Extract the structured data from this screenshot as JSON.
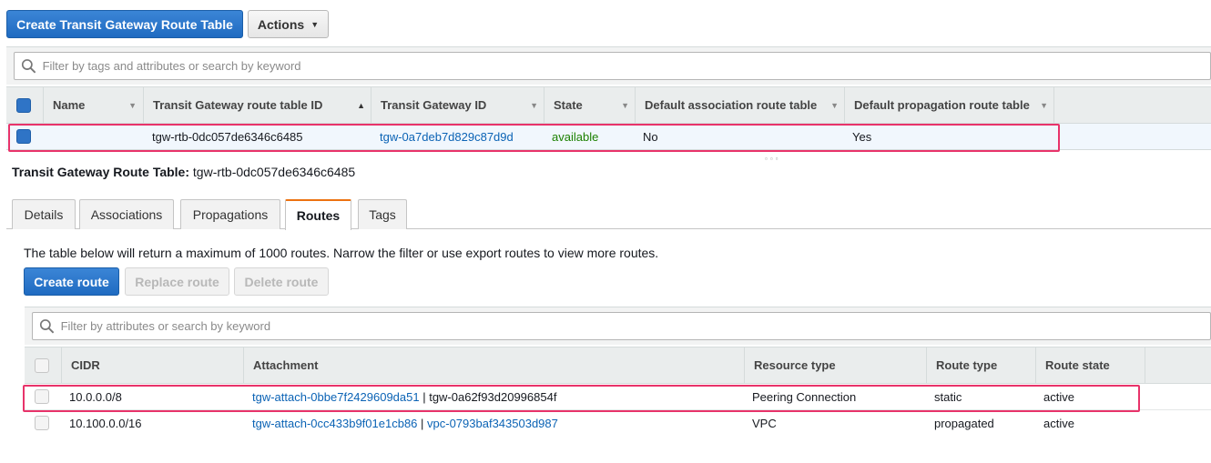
{
  "toolbar": {
    "create_label": "Create Transit Gateway Route Table",
    "actions_label": "Actions"
  },
  "top_search": {
    "placeholder": "Filter by tags and attributes or search by keyword"
  },
  "top_table": {
    "columns": [
      "Name",
      "Transit Gateway route table ID",
      "Transit Gateway ID",
      "State",
      "Default association route table",
      "Default propagation route table"
    ],
    "rows": [
      {
        "name": "",
        "route_table_id": "tgw-rtb-0dc057de6346c6485",
        "tgw_id": "tgw-0a7deb7d829c87d9d",
        "state": "available",
        "default_association": "No",
        "default_propagation": "Yes"
      }
    ]
  },
  "detail": {
    "title_label": "Transit Gateway Route Table:",
    "title_value": "tgw-rtb-0dc057de6346c6485"
  },
  "tabs": [
    {
      "label": "Details"
    },
    {
      "label": "Associations"
    },
    {
      "label": "Propagations"
    },
    {
      "label": "Routes"
    },
    {
      "label": "Tags"
    }
  ],
  "routes": {
    "notice": "The table below will return a maximum of 1000 routes. Narrow the filter or use export routes to view more routes.",
    "create_label": "Create route",
    "replace_label": "Replace route",
    "delete_label": "Delete route",
    "search_placeholder": "Filter by attributes or search by keyword",
    "columns": [
      "CIDR",
      "Attachment",
      "Resource type",
      "Route type",
      "Route state"
    ],
    "rows": [
      {
        "cidr": "10.0.0.0/8",
        "attachment": "tgw-attach-0bbe7f2429609da51",
        "separator": " | ",
        "resource": "tgw-0a62f93d20996854f",
        "resource_is_link": false,
        "resource_type": "Peering Connection",
        "route_type": "static",
        "route_state": "active"
      },
      {
        "cidr": "10.100.0.0/16",
        "attachment": "tgw-attach-0cc433b9f01e1cb86",
        "separator": " | ",
        "resource": "vpc-0793baf343503d987",
        "resource_is_link": true,
        "resource_type": "VPC",
        "route_type": "propagated",
        "route_state": "active"
      }
    ]
  },
  "colors": {
    "primary_button": "#1f6bc1",
    "link": "#0b63b5",
    "available": "#1d8102",
    "highlight": "#e8336a",
    "active_tab_accent": "#ec7211"
  },
  "icons": {
    "search": "search-icon",
    "dropdown": "caret-down-icon",
    "sort": "sort-icon"
  }
}
